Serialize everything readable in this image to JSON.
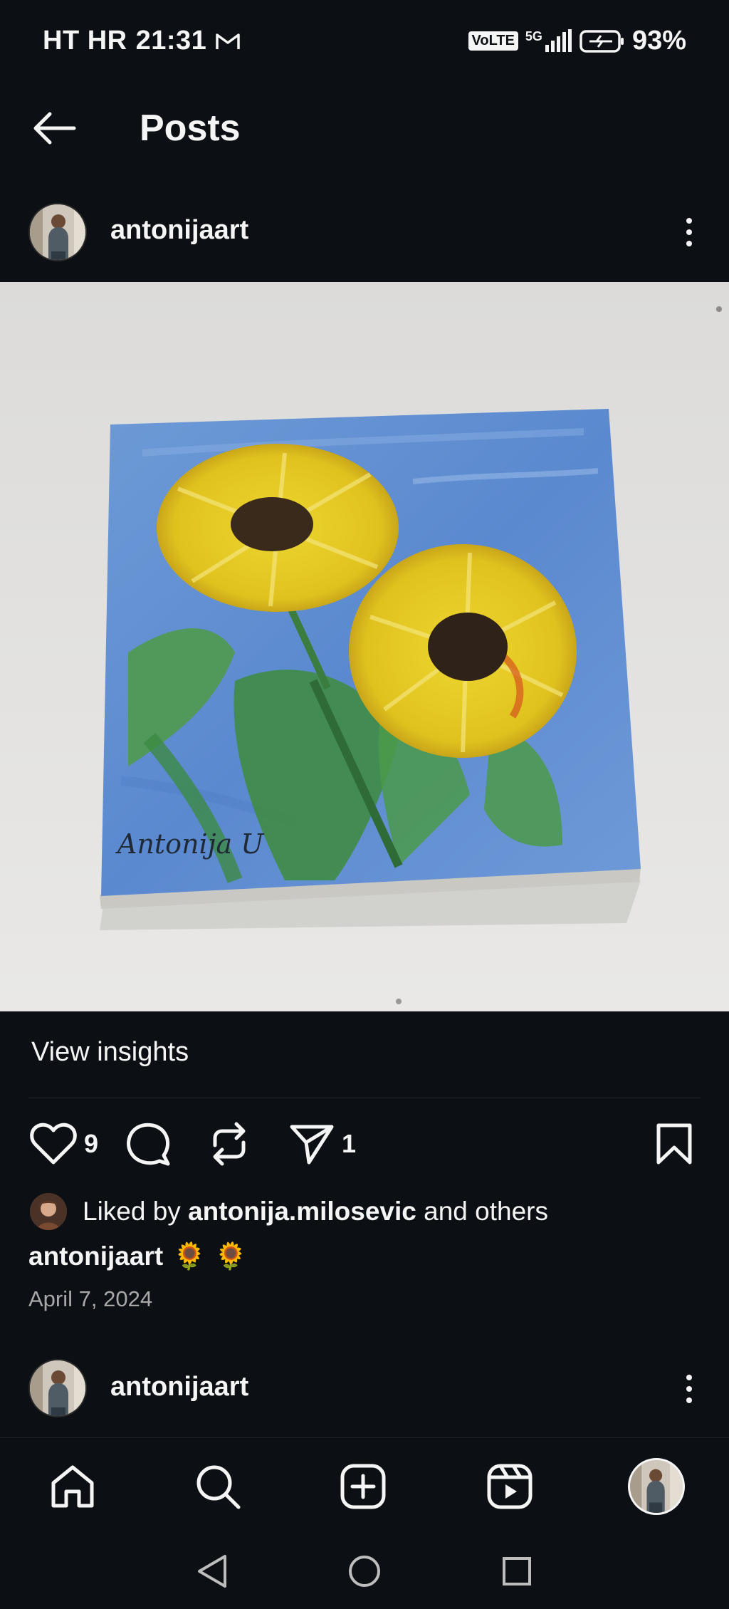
{
  "status_bar": {
    "carrier": "HT HR",
    "time": "21:31",
    "volte": "VoLTE",
    "network": "5G",
    "battery": "93%"
  },
  "header": {
    "title": "Posts"
  },
  "post": {
    "username": "antonijaart",
    "image_icon": "sunflower-painting",
    "signature": "Antonija U",
    "insights_label": "View insights",
    "likes_count": "9",
    "shares_count": "1",
    "liked_by_prefix": "Liked by",
    "liked_by_user": "antonija.milosevic",
    "liked_by_suffix": "and others",
    "caption_user": "antonijaart",
    "caption_text": "🌻 🌻",
    "date": "April 7, 2024"
  },
  "next_post": {
    "username": "antonijaart"
  },
  "colors": {
    "background": "#0c1014",
    "text": "#f5f5f5",
    "muted": "#a8a8a8"
  }
}
